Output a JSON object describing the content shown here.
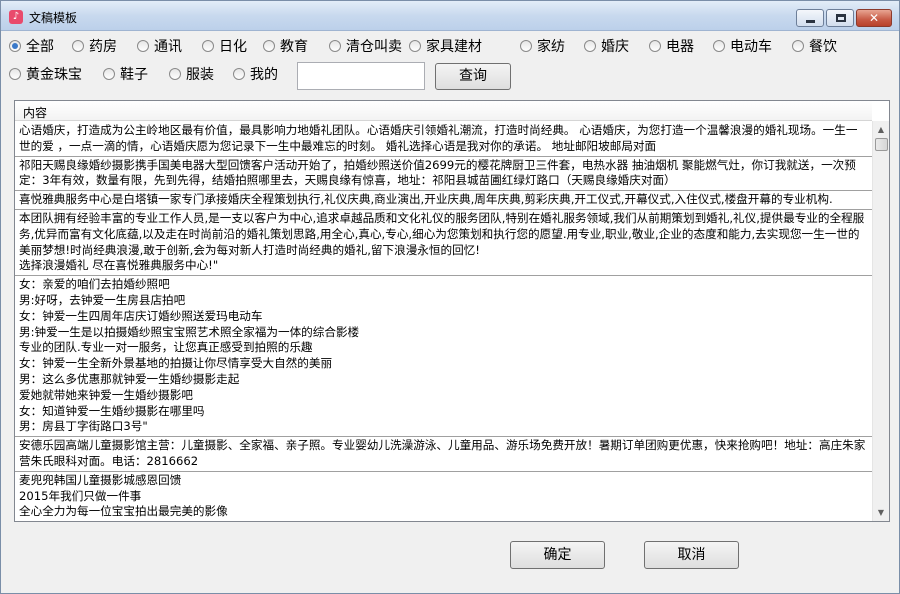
{
  "window": {
    "title": "文稿模板",
    "icon": "music-note-icon",
    "controls": {
      "minimize": "minimize-icon",
      "maximize": "maximize-icon",
      "close": "close-icon",
      "close_glyph": "✕"
    }
  },
  "filters": {
    "selected": "全部",
    "row1": [
      "全部",
      "药房",
      "通讯",
      "日化",
      "教育",
      "清仓叫卖",
      "家具建材",
      "家纺",
      "婚庆",
      "电器",
      "电动车",
      "餐饮"
    ],
    "row2": [
      "黄金珠宝",
      "鞋子",
      "服装",
      "我的"
    ]
  },
  "search": {
    "value": "",
    "button_label": "查询"
  },
  "list": {
    "column_header": "内容",
    "rows": [
      "心语婚庆，打造成为公主岭地区最有价值，最具影响力地婚礼团队。心语婚庆引领婚礼潮流，打造时尚经典。      心语婚庆，为您打造一个温馨浪漫的婚礼现场。一生一世的爱  ，一点一滴的情，心语婚庆愿为您记录下一生中最难忘的时刻。          婚礼选择心语是我对你的承诺。   地址邮阳坡邮局对面",
      "祁阳天赐良缘婚纱摄影携手国美电器大型回馈客户活动开始了，拍婚纱照送价值2699元的樱花牌厨卫三件套，电热水器 抽油烟机 聚能燃气灶，你订我就送，一次预定：3年有效，数量有限，先到先得，结婚拍照哪里去，天赐良缘有惊喜，地址：祁阳县城苗圃红绿灯路口（天赐良缘婚庆对面）",
      "喜悦雅典服务中心是白塔镇一家专门承接婚庆全程策划执行,礼仪庆典,商业演出,开业庆典,周年庆典,剪彩庆典,开工仪式,开幕仪式,入住仪式,楼盘开幕的专业机构.",
      "本团队拥有经验丰富的专业工作人员,是一支以客户为中心,追求卓越品质和文化礼仪的服务团队,特别在婚礼服务领域,我们从前期策划到婚礼,礼仪,提供最专业的全程服务,优异而富有文化底蕴,以及走在时尚前沿的婚礼策划思路,用全心,真心,专心,细心为您策划和执行您的愿望.用专业,职业,敬业,企业的态度和能力,去实现您一生一世的美丽梦想!时尚经典浪漫,敢于创新,会为每对新人打造时尚经典的婚礼,留下浪漫永恒的回忆!\n   选择浪漫婚礼   尽在喜悦雅典服务中心!\"",
      "女：亲爱的咱们去拍婚纱照吧\n男:好呀，去钟爱一生房县店拍吧\n女：钟爱一生四周年店庆订婚纱照送爱玛电动车\n男:钟爱一生是以拍摄婚纱照宝宝照艺术照全家福为一体的综合影楼\n专业的团队.专业一对一服务，让您真正感受到拍照的乐趣\n女：钟爱一生全新外景基地的拍摄让你尽情享受大自然的美丽\n男：这么多优惠那就钟爱一生婚纱摄影走起\n爱她就带她来钟爱一生婚纱摄影吧\n女：知道钟爱一生婚纱摄影在哪里吗\n男：房县丁字街路口3号\"",
      "安德乐园高端儿童摄影馆主营：儿童摄影、全家福、亲子照。专业婴幼儿洗澡游泳、儿童用品、游乐场免费开放！暑期订单团购更优惠，快来抢购吧！地址：高庄朱家营朱氏眼科对面。电话：2816662",
      "麦兜兜韩国儿童摄影城感恩回馈\n2015年我们只做一件事\n全心全力为每一位宝宝拍出最完美的影像"
    ]
  },
  "buttons": {
    "ok": "确定",
    "cancel": "取消"
  }
}
